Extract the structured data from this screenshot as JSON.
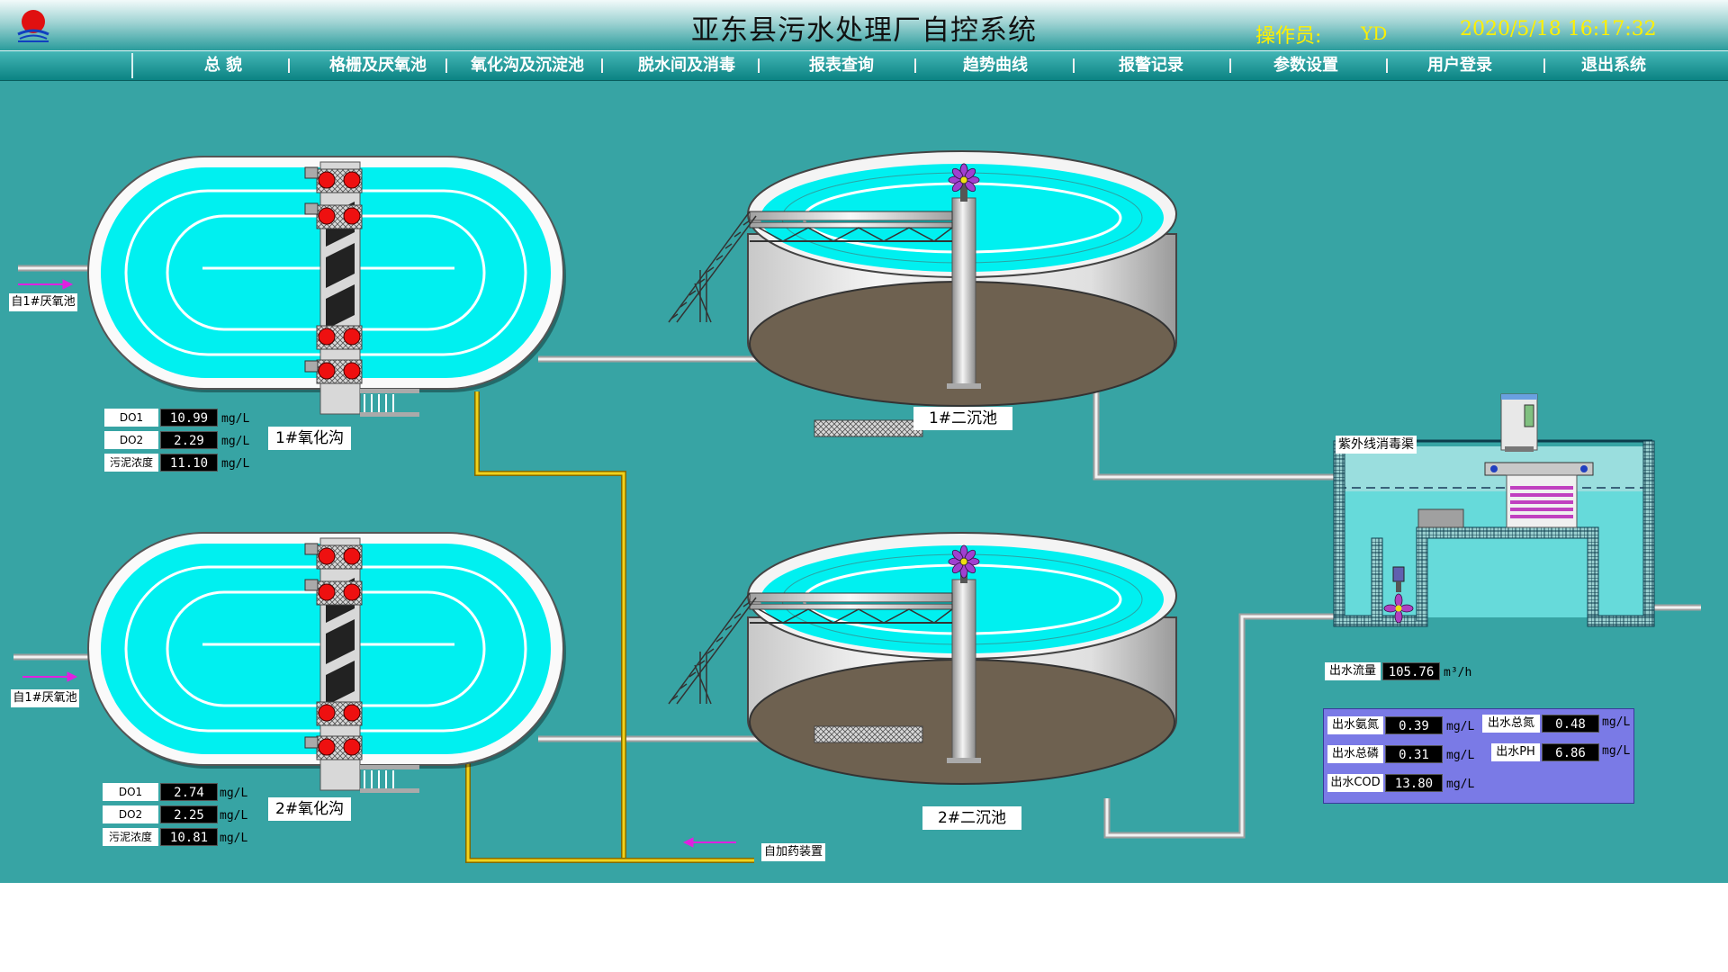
{
  "header": {
    "title": "亚东县污水处理厂自控系统",
    "operator_label": "操作员:",
    "operator_name": "YD",
    "datetime": "2020/5/18  16:17:32"
  },
  "nav": {
    "items": [
      {
        "label": "总  貌"
      },
      {
        "label": "格栅及厌氧池"
      },
      {
        "label": "氧化沟及沉淀池"
      },
      {
        "label": "脱水间及消毒"
      },
      {
        "label": "报表查询"
      },
      {
        "label": "趋势曲线"
      },
      {
        "label": "报警记录"
      },
      {
        "label": "参数设置"
      },
      {
        "label": "用户登录"
      },
      {
        "label": "退出系统"
      }
    ]
  },
  "ditch1": {
    "label": "1#氧化沟",
    "inlet": "自1#厌氧池",
    "do1": {
      "tag": "DO1",
      "value": "10.99",
      "unit": "mg/L"
    },
    "do2": {
      "tag": "DO2",
      "value": "2.29",
      "unit": "mg/L"
    },
    "sludge": {
      "tag": "污泥浓度",
      "value": "11.10",
      "unit": "mg/L"
    }
  },
  "ditch2": {
    "label": "2#氧化沟",
    "inlet": "自1#厌氧池",
    "do1": {
      "tag": "DO1",
      "value": "2.74",
      "unit": "mg/L"
    },
    "do2": {
      "tag": "DO2",
      "value": "2.25",
      "unit": "mg/L"
    },
    "sludge": {
      "tag": "污泥浓度",
      "value": "10.81",
      "unit": "mg/L"
    }
  },
  "clarifier1": {
    "label": "1#二沉池"
  },
  "clarifier2": {
    "label": "2#二沉池"
  },
  "dosing": {
    "label": "自加药装置"
  },
  "uv": {
    "label": "紫外线消毒渠"
  },
  "outflow": {
    "tag": "出水流量",
    "value": "105.76",
    "unit": "m³/h"
  },
  "quality": {
    "ammonia": {
      "tag": "出水氨氮",
      "value": "0.39",
      "unit": "mg/L"
    },
    "tn": {
      "tag": "出水总氮",
      "value": "0.48",
      "unit": "mg/L"
    },
    "tp": {
      "tag": "出水总磷",
      "value": "0.31",
      "unit": "mg/L"
    },
    "ph": {
      "tag": "出水PH",
      "value": "6.86",
      "unit": "mg/L"
    },
    "cod": {
      "tag": "出水COD",
      "value": "13.80",
      "unit": "mg/L"
    }
  },
  "colors": {
    "background": "#37a4a4",
    "water": "#00ffff",
    "pipe_yellow": "#f2d21a",
    "arrow": "#e020e0",
    "display_bg": "#000000",
    "panel": "#7a7ae6"
  },
  "icons": [
    "logo-icon",
    "aerator-rotor-icon",
    "mixer-icon",
    "uv-cabinet-icon",
    "pump-icon"
  ]
}
